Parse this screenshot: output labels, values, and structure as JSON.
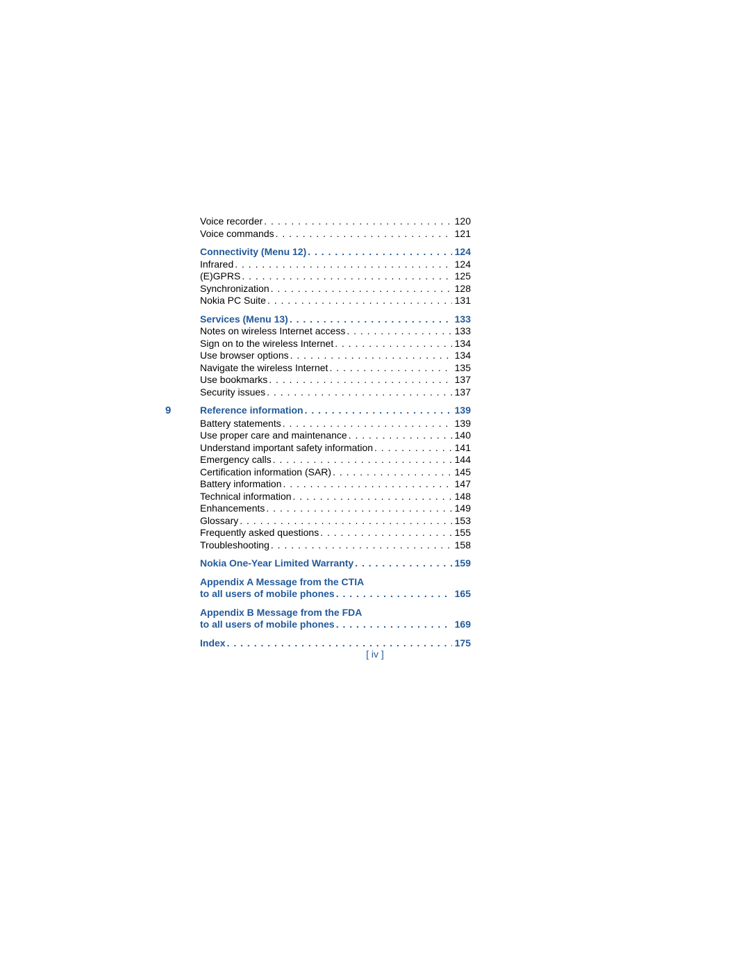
{
  "footer": "[ iv ]",
  "toc": [
    {
      "kind": "sub",
      "chapter": "",
      "title": "Voice recorder",
      "page": "120"
    },
    {
      "kind": "sub",
      "chapter": "",
      "title": "Voice commands",
      "page": "121"
    },
    {
      "kind": "section",
      "chapter": "",
      "title": "Connectivity (Menu 12)",
      "page": "124"
    },
    {
      "kind": "sub",
      "chapter": "",
      "title": "Infrared",
      "page": "124"
    },
    {
      "kind": "sub",
      "chapter": "",
      "title": "(E)GPRS",
      "page": "125"
    },
    {
      "kind": "sub",
      "chapter": "",
      "title": "Synchronization",
      "page": "128"
    },
    {
      "kind": "sub",
      "chapter": "",
      "title": "Nokia PC Suite",
      "page": "131"
    },
    {
      "kind": "section",
      "chapter": "",
      "title": "Services (Menu 13)",
      "page": "133"
    },
    {
      "kind": "sub",
      "chapter": "",
      "title": "Notes on wireless Internet access",
      "page": "133"
    },
    {
      "kind": "sub",
      "chapter": "",
      "title": "Sign on to the wireless Internet",
      "page": "134"
    },
    {
      "kind": "sub",
      "chapter": "",
      "title": "Use browser options",
      "page": "134"
    },
    {
      "kind": "sub",
      "chapter": "",
      "title": "Navigate the wireless Internet",
      "page": "135"
    },
    {
      "kind": "sub",
      "chapter": "",
      "title": "Use bookmarks",
      "page": "137"
    },
    {
      "kind": "sub",
      "chapter": "",
      "title": "Security issues",
      "page": "137"
    },
    {
      "kind": "section",
      "chapter": "9",
      "title": "Reference information",
      "page": "139"
    },
    {
      "kind": "sub",
      "chapter": "",
      "title": "Battery statements",
      "page": "139"
    },
    {
      "kind": "sub",
      "chapter": "",
      "title": "Use proper care and maintenance",
      "page": "140"
    },
    {
      "kind": "sub",
      "chapter": "",
      "title": "Understand important safety information",
      "page": "141"
    },
    {
      "kind": "sub",
      "chapter": "",
      "title": "Emergency calls",
      "page": "144"
    },
    {
      "kind": "sub",
      "chapter": "",
      "title": "Certification information (SAR)",
      "page": "145"
    },
    {
      "kind": "sub",
      "chapter": "",
      "title": "Battery information",
      "page": "147"
    },
    {
      "kind": "sub",
      "chapter": "",
      "title": "Technical information",
      "page": "148"
    },
    {
      "kind": "sub",
      "chapter": "",
      "title": "Enhancements",
      "page": "149"
    },
    {
      "kind": "sub",
      "chapter": "",
      "title": "Glossary",
      "page": "153"
    },
    {
      "kind": "sub",
      "chapter": "",
      "title": "Frequently asked questions",
      "page": "155"
    },
    {
      "kind": "sub",
      "chapter": "",
      "title": "Troubleshooting",
      "page": "158"
    },
    {
      "kind": "section",
      "chapter": "",
      "title": "Nokia One-Year Limited Warranty",
      "page": "159"
    },
    {
      "kind": "section",
      "chapter": "",
      "title": "Appendix A Message from the CTIA",
      "page": ""
    },
    {
      "kind": "cont",
      "chapter": "",
      "title": "to all users of mobile phones",
      "page": "165"
    },
    {
      "kind": "section",
      "chapter": "",
      "title": "Appendix B Message from the FDA",
      "page": ""
    },
    {
      "kind": "cont",
      "chapter": "",
      "title": "to all users of mobile phones",
      "page": "169"
    },
    {
      "kind": "section",
      "chapter": "",
      "title": "Index",
      "page": "175"
    }
  ]
}
